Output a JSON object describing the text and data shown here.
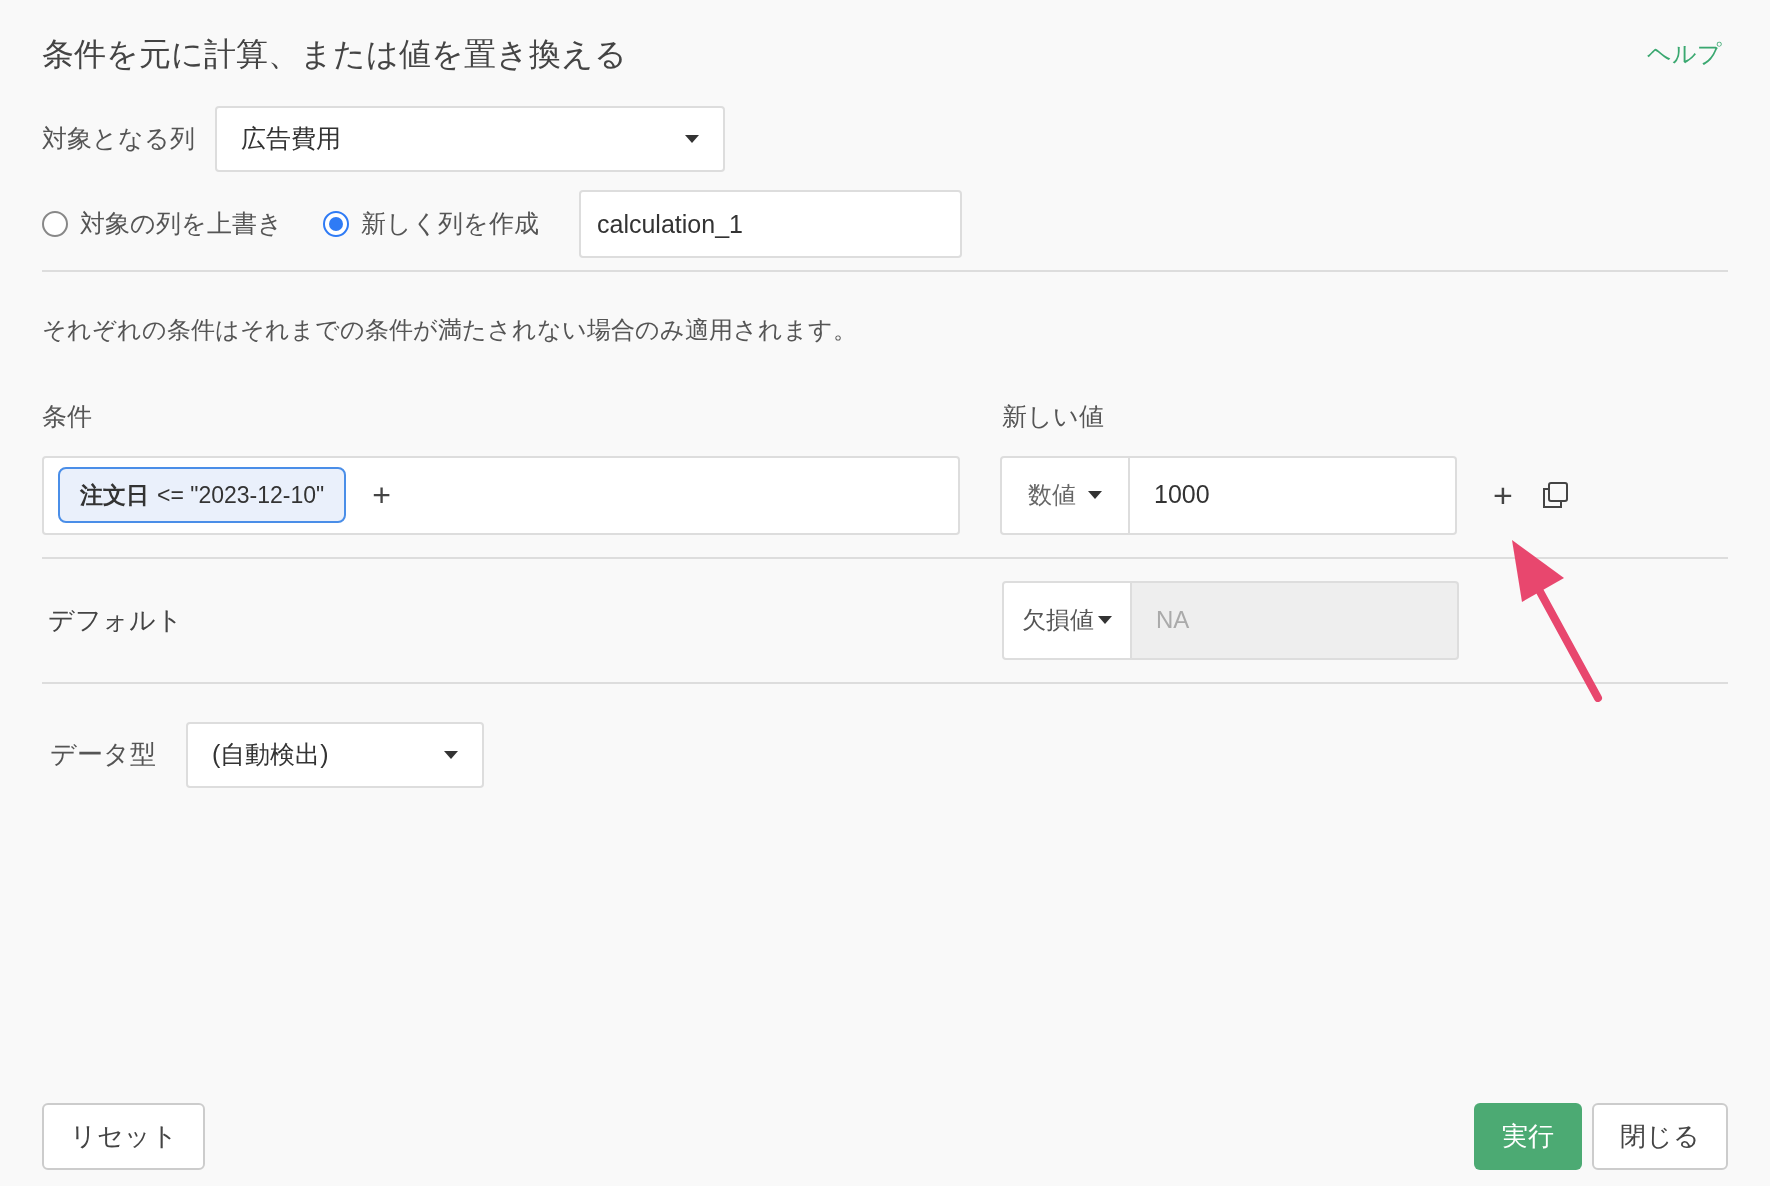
{
  "dialog": {
    "title": "条件を元に計算、または値を置き換える",
    "help_link": "ヘルプ"
  },
  "target_column": {
    "label": "対象となる列",
    "value": "広告費用"
  },
  "mode_options": [
    {
      "label": "対象の列を上書き",
      "selected": false
    },
    {
      "label": "新しく列を作成",
      "selected": true
    }
  ],
  "new_column_name": {
    "value": "calculation_1"
  },
  "info_text": "それぞれの条件はそれまでの条件が満たされない場合のみ適用されます。",
  "headers": {
    "condition": "条件",
    "new_value": "新しい値"
  },
  "rule": {
    "condition": {
      "column": "注文日",
      "expression": "<= \"2023-12-10\"",
      "add_symbol": "+"
    },
    "value_type": "数値",
    "value": "1000",
    "add_symbol": "+"
  },
  "default": {
    "label": "デフォルト",
    "value_type": "欠損値",
    "value": "NA",
    "disabled": true
  },
  "data_type": {
    "label": "データ型",
    "value": "(自動検出)"
  },
  "buttons": {
    "reset": "リセット",
    "run": "実行",
    "close": "閉じる"
  }
}
